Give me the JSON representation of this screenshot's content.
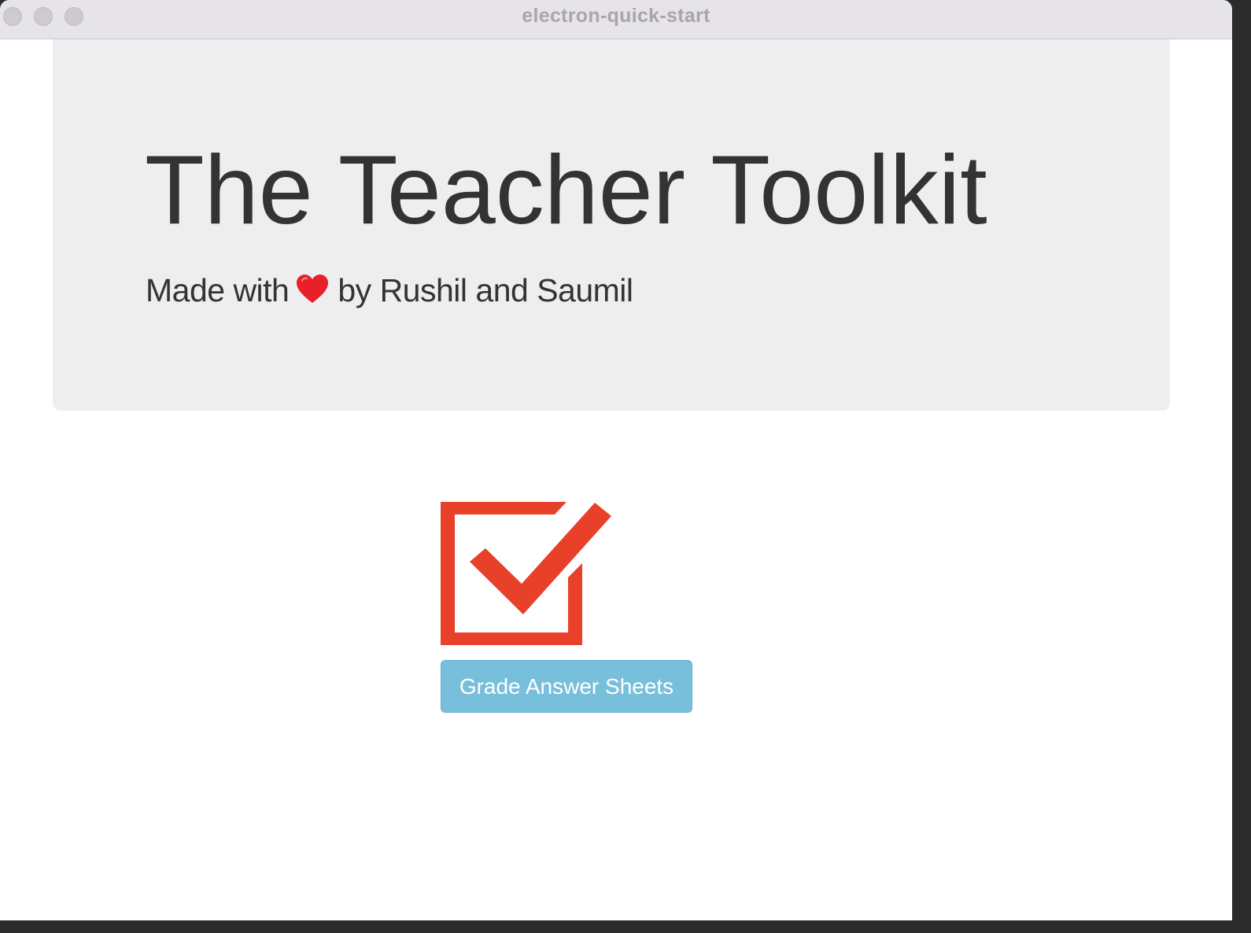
{
  "window": {
    "title": "electron-quick-start"
  },
  "jumbotron": {
    "title": "The Teacher Toolkit",
    "subtitle_before": "Made with",
    "subtitle_icon": "heart-icon",
    "subtitle_after": "by Rushil and Saumil"
  },
  "tool": {
    "icon": "checkbox-checkmark-icon",
    "button_label": "Grade Answer Sheets"
  },
  "colors": {
    "accent_red": "#e84029",
    "button_blue": "#78bfdc",
    "jumbotron_bg": "#eeeeee",
    "heading_text": "#333333"
  }
}
